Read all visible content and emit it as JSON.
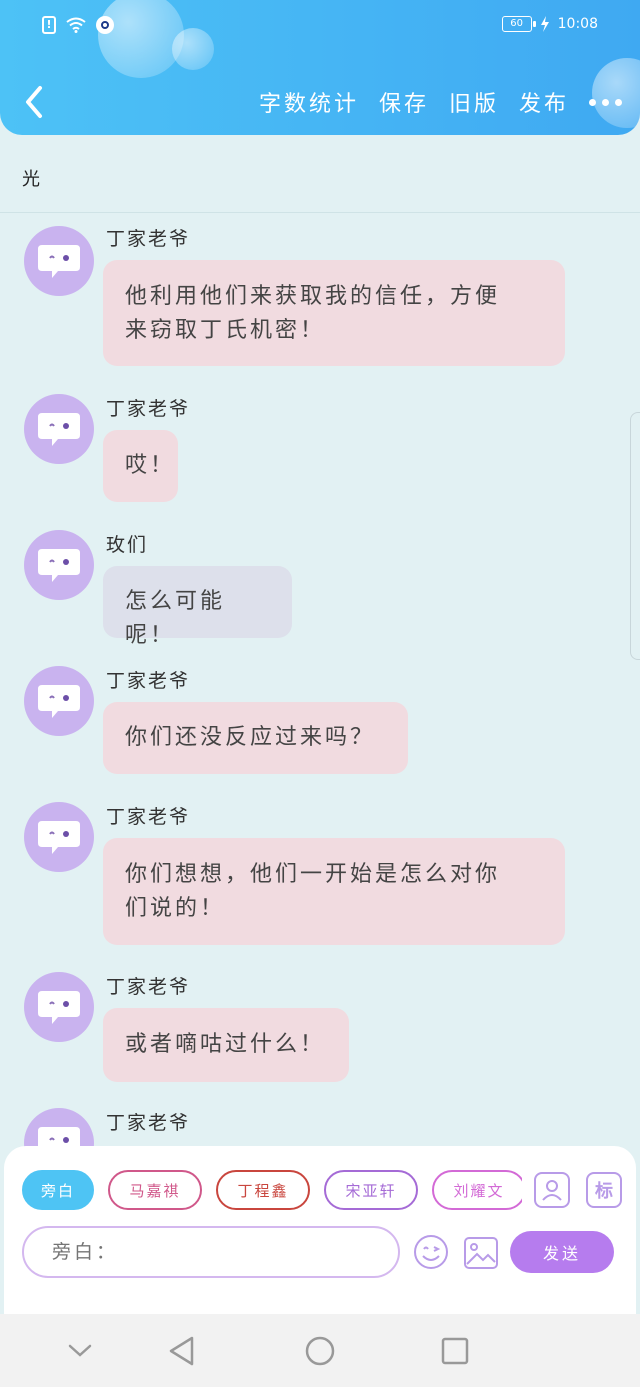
{
  "status_bar": {
    "time": "10:08",
    "battery": "60",
    "icons": [
      "alert-icon",
      "wifi-icon",
      "app-icon",
      "battery-icon",
      "charging-icon"
    ]
  },
  "header": {
    "actions": [
      "字数统计",
      "保存",
      "旧版",
      "发布"
    ],
    "colors": {
      "gradient_start": "#4dc2f6",
      "gradient_end": "#3fa9f2"
    }
  },
  "title": "光",
  "messages": [
    {
      "speaker": "丁家老爷",
      "lines": [
        "他利用他们来获取我的信任，方便",
        "来窃取丁氏机密！"
      ],
      "style": "pink"
    },
    {
      "speaker": "丁家老爷",
      "lines": [
        "哎！"
      ],
      "style": "pink"
    },
    {
      "speaker": "玫们",
      "lines": [
        "怎么可能呢！"
      ],
      "style": "gray"
    },
    {
      "speaker": "丁家老爷",
      "lines": [
        "你们还没反应过来吗？"
      ],
      "style": "pink"
    },
    {
      "speaker": "丁家老爷",
      "lines": [
        "你们想想，他们一开始是怎么对你",
        "们说的！"
      ],
      "style": "pink"
    },
    {
      "speaker": "丁家老爷",
      "lines": [
        "或者嘀咕过什么！"
      ],
      "style": "pink"
    },
    {
      "speaker": "丁家老爷",
      "lines": [],
      "style": "pink"
    }
  ],
  "composer": {
    "chips": [
      {
        "label": "旁白",
        "active": true,
        "color": "#4ec4f4"
      },
      {
        "label": "马嘉祺",
        "active": false,
        "color": "#d0588a"
      },
      {
        "label": "丁程鑫",
        "active": false,
        "color": "#c9463e"
      },
      {
        "label": "宋亚轩",
        "active": false,
        "color": "#a56bd6"
      },
      {
        "label": "刘耀文",
        "active": false,
        "color": "#d36ad6"
      }
    ],
    "side_icons": [
      "person-icon",
      "tag-icon"
    ],
    "tag_label": "标",
    "input_placeholder": "旁白：",
    "send_label": "发送"
  },
  "navbar": {
    "icons": [
      "chevron-down-icon",
      "back-triangle-icon",
      "home-circle-icon",
      "recents-square-icon"
    ]
  }
}
